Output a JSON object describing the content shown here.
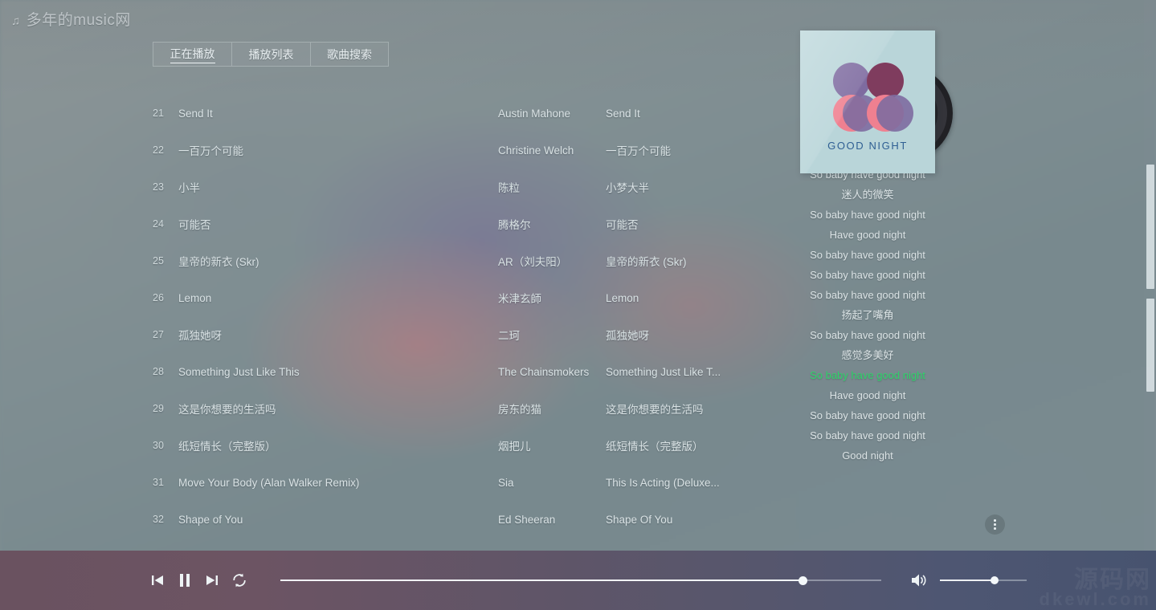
{
  "header": {
    "note_icon": "♫",
    "title": "多年的music网"
  },
  "tabs": [
    {
      "label": "正在播放",
      "active": true
    },
    {
      "label": "播放列表",
      "active": false
    },
    {
      "label": "歌曲搜索",
      "active": false
    }
  ],
  "playlist": {
    "rows": [
      {
        "index": "21",
        "title": "Send It",
        "artist": "Austin Mahone",
        "album": "Send It"
      },
      {
        "index": "22",
        "title": "一百万个可能",
        "artist": "Christine Welch",
        "album": "一百万个可能"
      },
      {
        "index": "23",
        "title": "小半",
        "artist": "陈粒",
        "album": "小梦大半"
      },
      {
        "index": "24",
        "title": "可能否",
        "artist": "腾格尔",
        "album": "可能否"
      },
      {
        "index": "25",
        "title": "皇帝的新衣 (Skr)",
        "artist": "AR（刘夫阳）",
        "album": "皇帝的新衣 (Skr)"
      },
      {
        "index": "26",
        "title": "Lemon",
        "artist": "米津玄師",
        "album": "Lemon"
      },
      {
        "index": "27",
        "title": "孤独她呀",
        "artist": "二珂",
        "album": "孤独她呀"
      },
      {
        "index": "28",
        "title": "Something Just Like This",
        "artist": "The Chainsmokers",
        "album": "Something Just Like T..."
      },
      {
        "index": "29",
        "title": "这是你想要的生活吗",
        "artist": "房东的猫",
        "album": "这是你想要的生活吗"
      },
      {
        "index": "30",
        "title": "纸短情长（完整版）",
        "artist": "烟把儿",
        "album": "纸短情长（完整版）"
      },
      {
        "index": "31",
        "title": "Move Your Body (Alan Walker Remix)",
        "artist": "Sia",
        "album": "This Is Acting (Deluxe..."
      },
      {
        "index": "32",
        "title": "Shape of You",
        "artist": "Ed Sheeran",
        "album": "Shape Of You"
      }
    ]
  },
  "cover": {
    "title": "GOOD NIGHT"
  },
  "lyrics": {
    "active_color": "#2fd46a",
    "lines": [
      {
        "text": "So baby have good night",
        "active": false
      },
      {
        "text": "迷人的微笑",
        "active": false
      },
      {
        "text": "So baby have good night",
        "active": false
      },
      {
        "text": "Have good night",
        "active": false
      },
      {
        "text": "So baby have good night",
        "active": false
      },
      {
        "text": "So baby have good night",
        "active": false
      },
      {
        "text": "So baby have good night",
        "active": false
      },
      {
        "text": "扬起了嘴角",
        "active": false
      },
      {
        "text": "So baby have good night",
        "active": false
      },
      {
        "text": "感觉多美好",
        "active": false
      },
      {
        "text": "So baby have good night",
        "active": true
      },
      {
        "text": "",
        "active": false
      },
      {
        "text": "",
        "active": false
      },
      {
        "text": "Have good night",
        "active": false
      },
      {
        "text": "So baby have good night",
        "active": false
      },
      {
        "text": "So baby have good night",
        "active": false
      },
      {
        "text": "",
        "active": false
      },
      {
        "text": "",
        "active": false
      },
      {
        "text": "Good night",
        "active": false
      }
    ]
  },
  "more_button": {
    "icon": "three-dots-vertical"
  },
  "player": {
    "previous_icon": "skip-previous-icon",
    "play_pause_icon": "pause-icon",
    "next_icon": "skip-next-icon",
    "repeat_icon": "repeat-icon",
    "progress_percent": 87,
    "volume_percent": 63,
    "volume_icon": "speaker-icon",
    "watermark_main": "源码网",
    "watermark_sub": "dkewl.com"
  }
}
